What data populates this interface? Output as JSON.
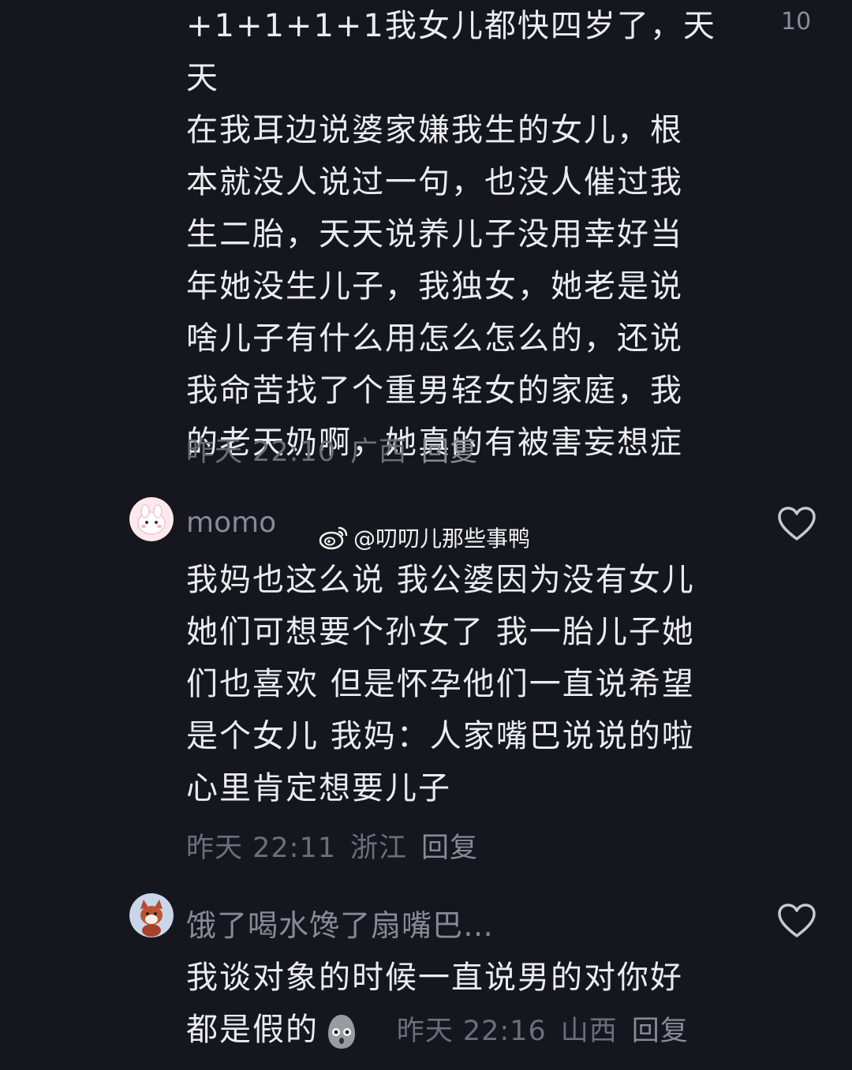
{
  "comment1": {
    "likes": "10",
    "lines": [
      "+1+1+1+1我女儿都快四岁了，天天",
      "在我耳边说婆家嫌我生的女儿，根",
      "本就没人说过一句，也没人催过我",
      "生二胎，天天说养儿子没用幸好当",
      "年她没生儿子，我独女，她老是说",
      "啥儿子有什么用怎么怎么的，还说",
      "我命苦找了个重男轻女的家庭，我",
      "的老天奶啊，她真的有被害妄想症"
    ],
    "time": "昨天 22:10",
    "location": "广西",
    "reply_label": "回复"
  },
  "comment2": {
    "username": "momo",
    "lines": [
      "我妈也这么说 我公婆因为没有女儿",
      "她们可想要个孙女了 我一胎儿子她",
      "们也喜欢 但是怀孕他们一直说希望",
      "是个女儿 我妈：人家嘴巴说说的啦",
      "心里肯定想要儿子"
    ],
    "time": "昨天 22:11",
    "location": "浙江",
    "reply_label": "回复"
  },
  "watermark": "@叨叨儿那些事鸭",
  "comment3": {
    "username": "饿了喝水馋了扇嘴巴…",
    "lines": [
      "我谈对象的时候一直说男的对你好",
      "都是假的"
    ],
    "time": "昨天 22:16",
    "location": "山西",
    "reply_label": "回复"
  },
  "icons": {
    "like": "heart-outline-icon",
    "watermark": "weibo-logo-icon",
    "emoji": "shocked-face-emoji"
  },
  "colors": {
    "background": "#16161e",
    "text": "#ececf0",
    "meta": "#6e6e78"
  }
}
